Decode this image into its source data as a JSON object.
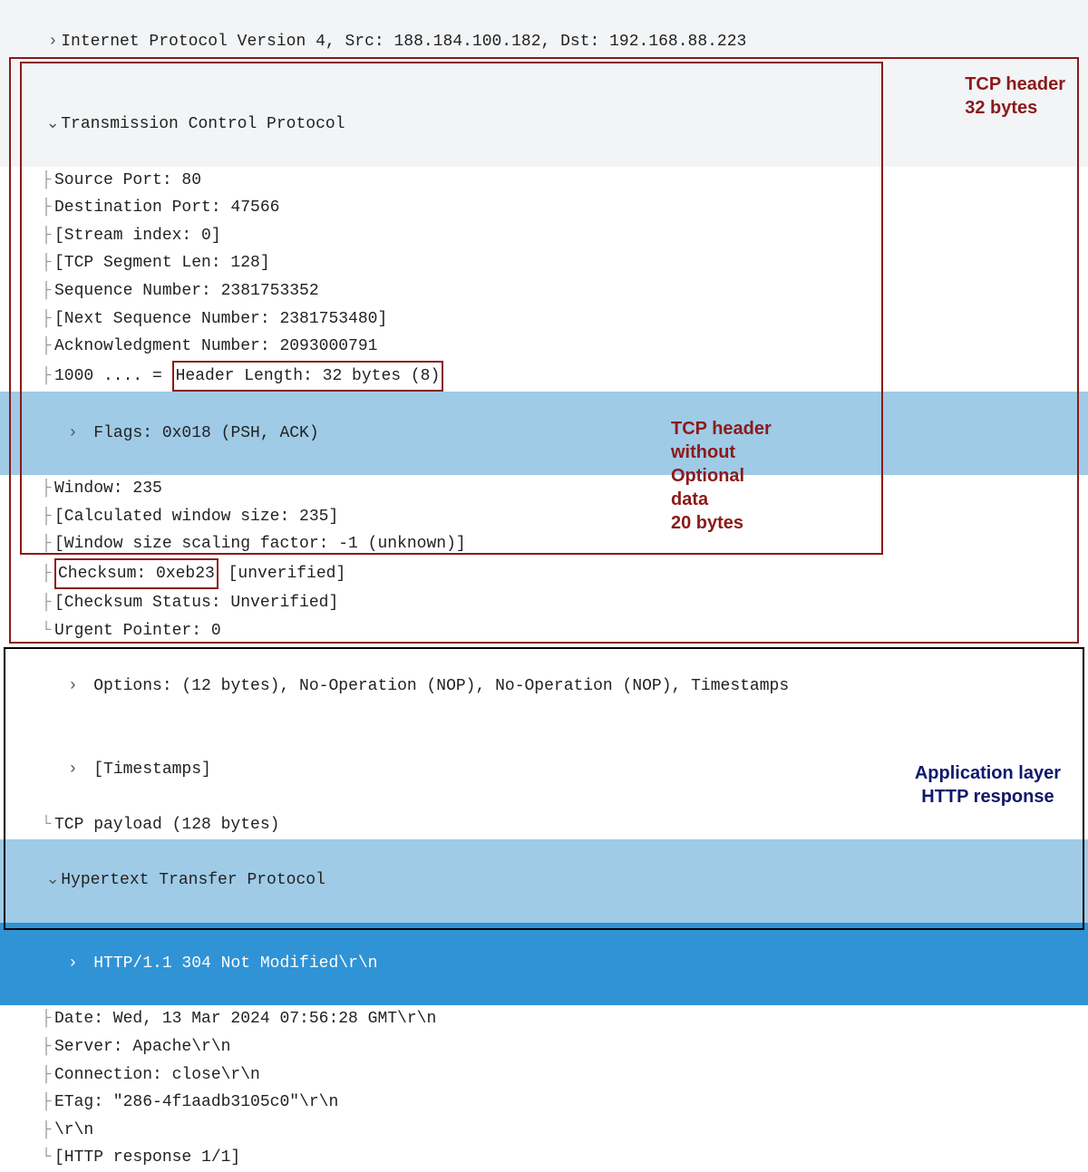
{
  "ip": {
    "line": "Internet Protocol Version 4, Src: 188.184.100.182, Dst: 192.168.88.223"
  },
  "tcp": {
    "header": "Transmission Control Protocol",
    "src_port": "Source Port: 80",
    "dst_port": "Destination Port: 47566",
    "stream_index": "[Stream index: 0]",
    "seg_len": "[TCP Segment Len: 128]",
    "seq": "Sequence Number: 2381753352",
    "next_seq": "[Next Sequence Number: 2381753480]",
    "ack": "Acknowledgment Number: 2093000791",
    "hlen_prefix": "1000 .... = ",
    "hlen_box": "Header Length: 32 bytes (8)",
    "flags": "Flags: 0x018 (PSH, ACK)",
    "window": "Window: 235",
    "calc_win": "[Calculated window size: 235]",
    "scale": "[Window size scaling factor: -1 (unknown)]",
    "cksum_box": "Checksum: 0xeb23",
    "cksum_suffix": " [unverified]",
    "cksum_status": "[Checksum Status: Unverified]",
    "urgent": "Urgent Pointer: 0",
    "options": "Options: (12 bytes), No-Operation (NOP), No-Operation (NOP), Timestamps",
    "timestamps": "[Timestamps]",
    "payload": "TCP payload (128 bytes)"
  },
  "http": {
    "header": "Hypertext Transfer Protocol",
    "status": "HTTP/1.1 304 Not Modified\\r\\n",
    "date": "Date: Wed, 13 Mar 2024 07:56:28 GMT\\r\\n",
    "server": "Server: Apache\\r\\n",
    "connection": "Connection: close\\r\\n",
    "etag": "ETag: \"286-4f1aadb3105c0\"\\r\\n",
    "crlf": "\\r\\n",
    "resp_count": "[HTTP response 1/1]"
  },
  "labels": {
    "tcp_header": "TCP header\n32 bytes",
    "tcp_20": "TCP header\nwithout\nOptional\ndata\n20 bytes",
    "app_layer": "Application layer\nHTTP response"
  },
  "colors": {
    "dark_red": "#8b1a1a",
    "dark_blue": "#10186b",
    "black": "#000000"
  }
}
